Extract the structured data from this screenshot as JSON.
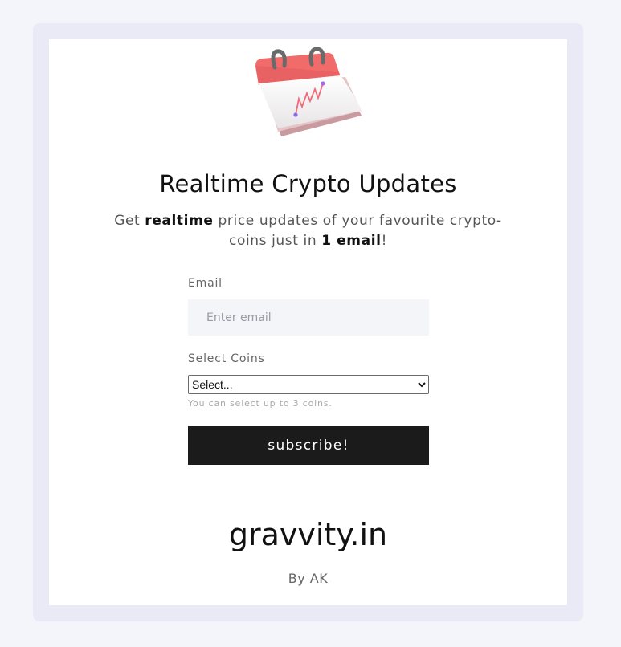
{
  "header": {
    "title": "Realtime Crypto Updates",
    "subtitle_parts": [
      "Get ",
      "realtime",
      " price updates of your favourite crypto-coins just in ",
      "1 email",
      "!"
    ]
  },
  "form": {
    "email_label": "Email",
    "email_placeholder": "Enter email",
    "email_value": "",
    "coins_label": "Select Coins",
    "coins_selected": "Select...",
    "coins_hint": "You can select up to 3 coins.",
    "submit_label": "subscribe!"
  },
  "footer": {
    "brand": "gravvity.in",
    "by_prefix": "By ",
    "author": "AK"
  },
  "icons": {
    "hero": "calendar-chart-icon"
  },
  "colors": {
    "page_bg": "#f4f5fa",
    "frame_bg": "#e9eaf6",
    "card_bg": "#ffffff",
    "button_bg": "#1b1b1b",
    "calendar_red": "#f26b6b"
  }
}
